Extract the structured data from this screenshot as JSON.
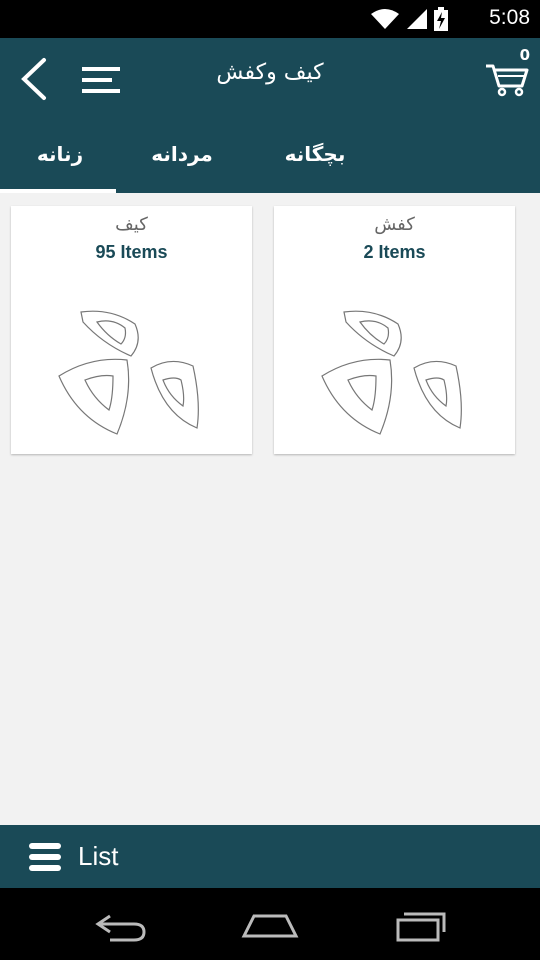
{
  "status_bar": {
    "time": "5:08",
    "icons": [
      "wifi-icon",
      "signal-icon",
      "battery-charging-icon"
    ]
  },
  "app_bar": {
    "title": "کیف وکفش",
    "cart_count": "0",
    "back_icon": "back-chevron-icon",
    "menu_icon": "hamburger-menu-icon",
    "cart_icon": "cart-icon"
  },
  "tabs": {
    "women": "زنانه",
    "men": "مردانه",
    "kids": "بچگانه",
    "active": "women"
  },
  "cards": [
    {
      "title": "کیف",
      "count": "95 Items",
      "image_icon": "placeholder-shapes-icon"
    },
    {
      "title": "کفش",
      "count": "2 Items",
      "image_icon": "placeholder-shapes-icon"
    }
  ],
  "bottom_bar": {
    "label": "List",
    "icon": "list-menu-icon"
  },
  "nav_bar": {
    "back": "nav-back-icon",
    "home": "nav-home-icon",
    "recents": "nav-recents-icon"
  },
  "colors": {
    "primary": "#1a4a57",
    "background": "#f2f2f2",
    "card": "#ffffff"
  }
}
